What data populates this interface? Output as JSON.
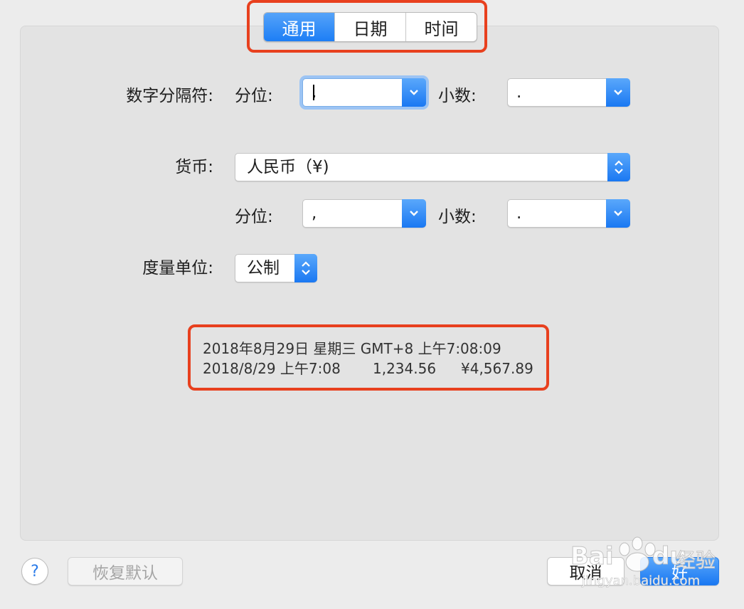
{
  "tabs": [
    {
      "label": "通用",
      "active": true
    },
    {
      "label": "日期",
      "active": false
    },
    {
      "label": "时间",
      "active": false
    }
  ],
  "number_separators": {
    "label": "数字分隔符:",
    "grouping_label": "分位:",
    "grouping_value": ",",
    "decimal_label": "小数:",
    "decimal_value": "."
  },
  "currency": {
    "label": "货币:",
    "value": "人民币（¥)",
    "grouping_label": "分位:",
    "grouping_value": ",",
    "decimal_label": "小数:",
    "decimal_value": "."
  },
  "measurement": {
    "label": "度量单位:",
    "value": "公制"
  },
  "preview": {
    "line1": "2018年8月29日 星期三 GMT+8 上午7:08:09",
    "line2_date": "2018/8/29 上午7:08",
    "line2_number": "1,234.56",
    "line2_currency": "¥4,567.89"
  },
  "footer": {
    "help_label": "?",
    "restore_label": "恢复默认",
    "cancel_label": "取消",
    "ok_label": "好"
  },
  "watermark": {
    "brand": "Bai",
    "brand2": "du",
    "jingyan": "经验",
    "url": "jingyan.baidu.com"
  },
  "colors": {
    "accent": "#1d7ef5",
    "highlight": "#e8401e"
  }
}
